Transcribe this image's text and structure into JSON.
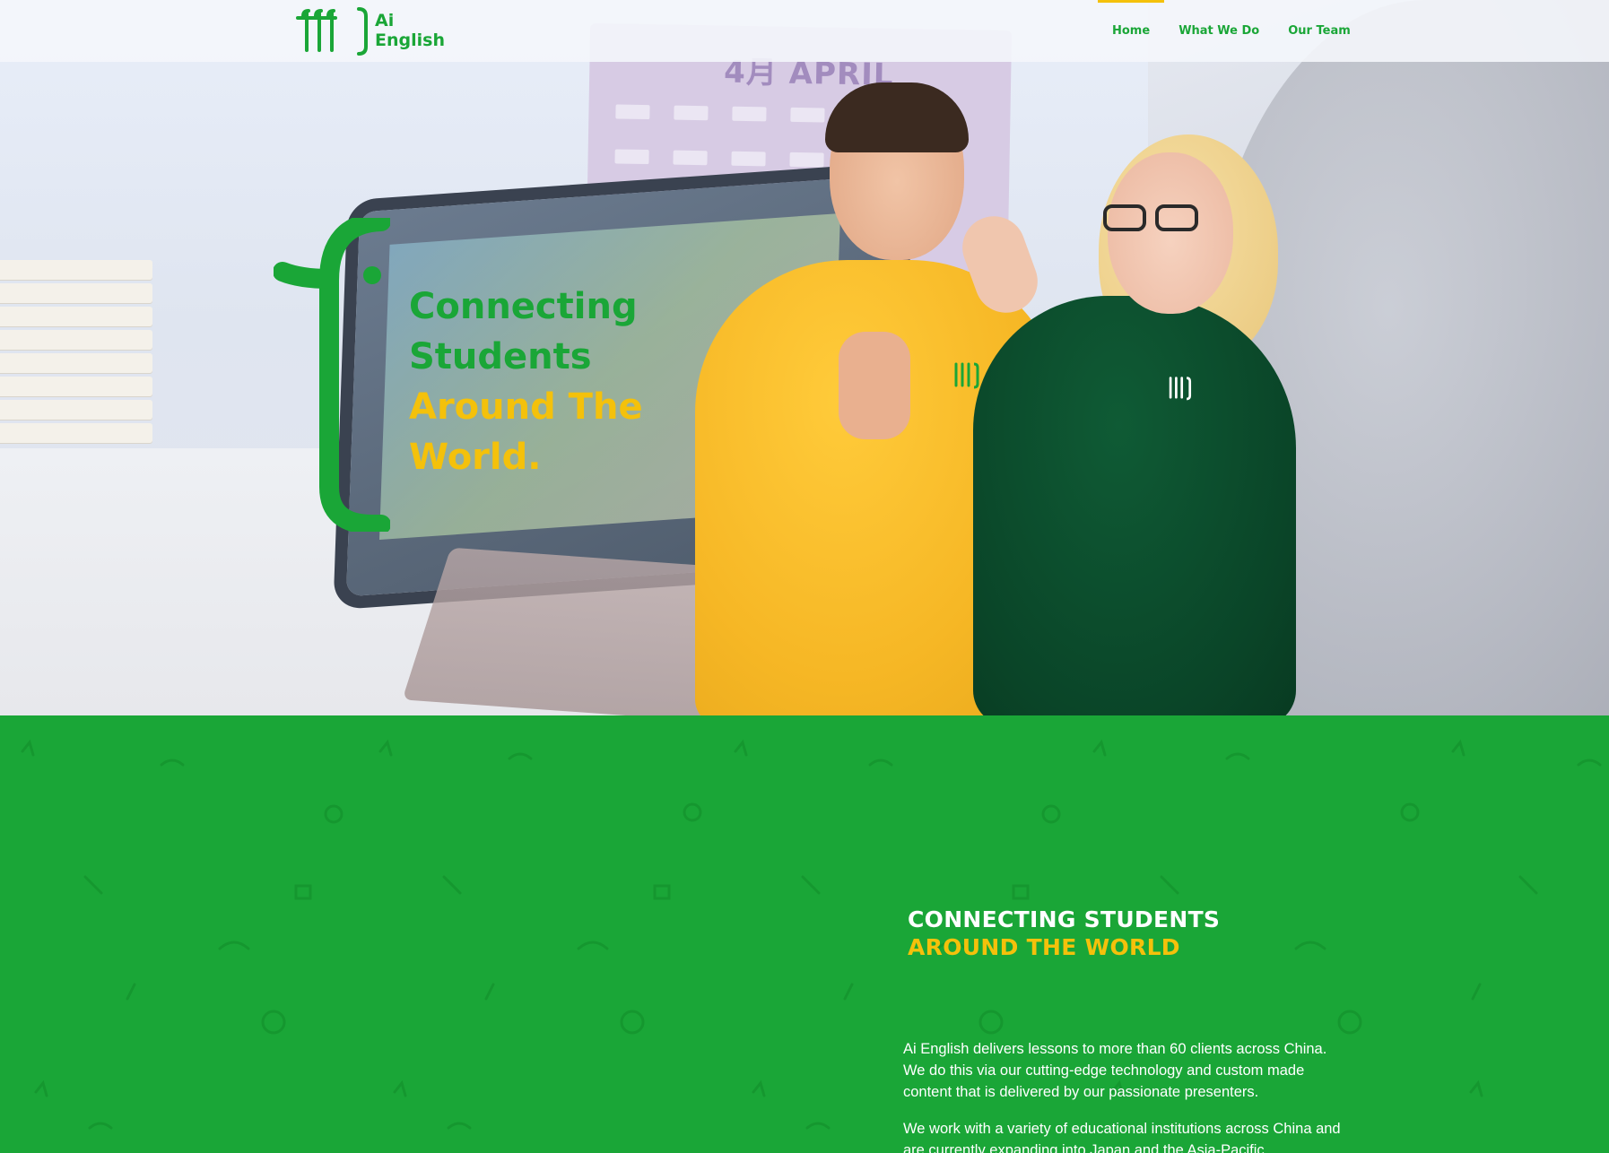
{
  "brand": {
    "logo_text_line1": "Ai",
    "logo_text_line2": "English",
    "primary_green": "#1aa637",
    "accent_yellow": "#f4c10b"
  },
  "nav": {
    "items": [
      {
        "label": "Home",
        "active": true
      },
      {
        "label": "What We Do",
        "active": false
      },
      {
        "label": "Our Team",
        "active": false
      }
    ]
  },
  "hero": {
    "headline_line1": "Connecting",
    "headline_line2": "Students",
    "headline_line3": "Around The",
    "headline_line4": "World.",
    "calendar_text": "4月 APRIL"
  },
  "about": {
    "heading_line1": "CONNECTING STUDENTS",
    "heading_line2": "AROUND THE WORLD",
    "paragraph1": "Ai English delivers lessons to more than 60 clients across China. We do this via our cutting-edge technology and custom made content that is delivered by our passionate presenters.",
    "paragraph2": "We work with a variety of educational institutions across China and are currently expanding into Japan and the Asia-Pacific"
  }
}
